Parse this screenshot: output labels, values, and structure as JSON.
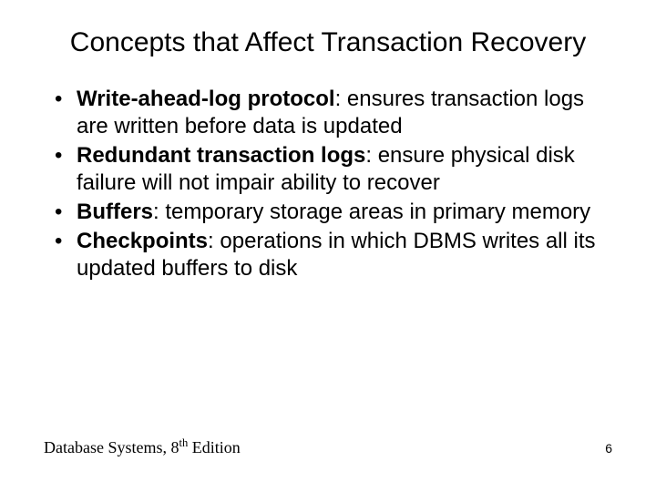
{
  "title": "Concepts that Affect Transaction Recovery",
  "bullets": [
    {
      "term": "Write-ahead-log protocol",
      "desc": ": ensures transaction logs are written before data is updated"
    },
    {
      "term": "Redundant transaction logs",
      "desc": ": ensure physical disk failure will not impair ability to recover"
    },
    {
      "term": "Buffers",
      "desc": ": temporary storage areas in primary memory"
    },
    {
      "term": "Checkpoints",
      "desc": ": operations in which DBMS writes all its updated buffers to disk"
    }
  ],
  "footer": {
    "source_prefix": "Database Systems, 8",
    "source_suffix": " Edition",
    "ordinal": "th",
    "page": "6"
  }
}
